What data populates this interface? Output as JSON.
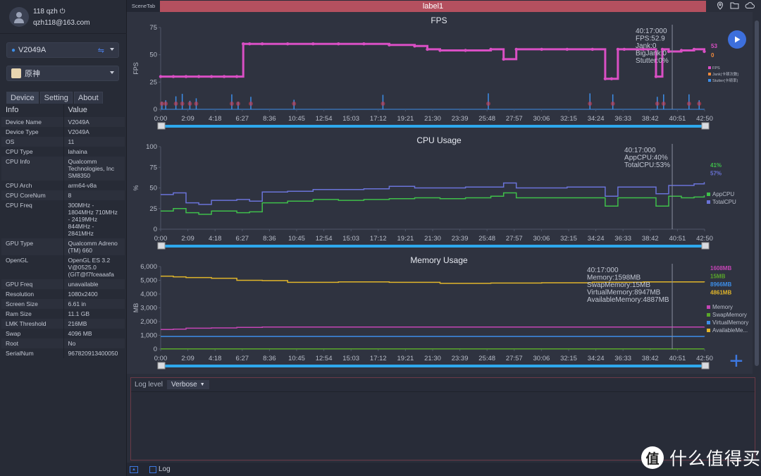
{
  "user": {
    "name": "118 qzh",
    "email": "qzh118@163.com"
  },
  "device_select": {
    "value": "V2049A"
  },
  "app_select": {
    "value": "原神"
  },
  "tabs": [
    {
      "label": "Device"
    },
    {
      "label": "Setting"
    },
    {
      "label": "About"
    }
  ],
  "info_table": {
    "headers": [
      "Info",
      "Value"
    ],
    "rows": [
      [
        "Device Name",
        "V2049A"
      ],
      [
        "Device Type",
        "V2049A"
      ],
      [
        "OS",
        "11"
      ],
      [
        "CPU Type",
        "lahaina"
      ],
      [
        "CPU Info",
        "Qualcomm Technologies, Inc SM8350"
      ],
      [
        "CPU Arch",
        "arm64-v8a"
      ],
      [
        "CPU CoreNum",
        "8"
      ],
      [
        "CPU Freq",
        "300MHz - 1804MHz 710MHz - 2419MHz 844MHz - 2841MHz"
      ],
      [
        "GPU Type",
        "Qualcomm Adreno (TM) 660"
      ],
      [
        "OpenGL",
        "OpenGL ES 3.2 V@0525.0 (GIT@f7fceaaafa"
      ],
      [
        "GPU Freq",
        "unavailable"
      ],
      [
        "Resolution",
        "1080x2400"
      ],
      [
        "Screen Size",
        "6.61 in"
      ],
      [
        "Ram Size",
        "11.1 GB"
      ],
      [
        "LMK Threshold",
        "216MB"
      ],
      [
        "Swap",
        "4096 MB"
      ],
      [
        "Root",
        "No"
      ],
      [
        "SerialNum",
        "967820913400050"
      ]
    ]
  },
  "scene_tab": "SceneTab",
  "label_tab": "label1",
  "log": {
    "level_label": "Log level",
    "level_value": "Verbose",
    "checkbox_label": "Log"
  },
  "watermark": {
    "badge": "值",
    "text": "什么值得买"
  },
  "colors": {
    "fps": "#d94fc4",
    "jank": "#f08a3c",
    "stutter": "#3d8ee8",
    "app_cpu": "#3fbf4a",
    "total_cpu": "#6a73d8",
    "memory": "#c445b5",
    "swap": "#5aa82a",
    "virtual": "#3d8ee8",
    "available": "#e0b52a",
    "label_tab": "#b4505f"
  },
  "chart_data": [
    {
      "type": "line",
      "title": "FPS",
      "ylabel": "FPS",
      "ylim": [
        0,
        75
      ],
      "yticks": [
        "0",
        "25",
        "50",
        "75"
      ],
      "xticks": [
        "0:00",
        "2:09",
        "4:18",
        "6:27",
        "8:36",
        "10:45",
        "12:54",
        "15:03",
        "17:12",
        "19:21",
        "21:30",
        "23:39",
        "25:48",
        "27:57",
        "30:06",
        "32:15",
        "34:24",
        "36:33",
        "38:42",
        "40:51",
        "42:50"
      ],
      "series": [
        {
          "name": "FPS",
          "x_min": [
            0,
            1,
            2,
            3,
            4,
            5,
            6,
            6.5,
            7,
            8,
            10,
            12,
            14,
            16,
            18,
            20,
            21,
            22,
            24,
            26,
            27,
            28,
            30,
            32,
            34,
            35,
            35.5,
            36,
            36.5,
            38,
            39,
            39.5,
            40,
            41,
            42,
            42.8
          ],
          "values": [
            30,
            30,
            30,
            30,
            30,
            30,
            30,
            60,
            60,
            60,
            60,
            60,
            60,
            60,
            59,
            58,
            55,
            54,
            54,
            55,
            46,
            55,
            55,
            55,
            55,
            28,
            28,
            55,
            55,
            55,
            30,
            55,
            53,
            54,
            55,
            53
          ]
        },
        {
          "name": "Jank(卡顿次数)",
          "values": []
        },
        {
          "name": "Stutter(卡顿率)",
          "values": []
        }
      ],
      "current_values": {
        "FPS": "53",
        "Jank": "0"
      },
      "tooltip": {
        "time": "40:17:000",
        "lines": [
          "FPS:52.9",
          "Jank:0",
          "BigJank:0",
          "Stutter:0%"
        ]
      }
    },
    {
      "type": "line",
      "title": "CPU Usage",
      "ylabel": "%",
      "ylim": [
        0,
        100
      ],
      "yticks": [
        "0",
        "25",
        "50",
        "75",
        "100"
      ],
      "xticks": [
        "0:00",
        "2:09",
        "4:18",
        "6:27",
        "8:36",
        "10:45",
        "12:54",
        "15:03",
        "17:12",
        "19:21",
        "21:30",
        "23:39",
        "25:48",
        "27:57",
        "30:06",
        "32:15",
        "34:24",
        "36:33",
        "38:42",
        "40:51",
        "42:50"
      ],
      "series": [
        {
          "name": "AppCPU",
          "x_min": [
            0,
            1,
            2,
            3,
            4,
            5,
            6,
            7,
            8,
            10,
            12,
            14,
            16,
            18,
            20,
            22,
            24,
            26,
            27,
            28,
            30,
            32,
            34,
            35,
            36,
            38,
            39,
            40,
            41,
            42,
            42.8
          ],
          "values": [
            22,
            25,
            20,
            18,
            22,
            22,
            20,
            21,
            32,
            34,
            36,
            35,
            36,
            37,
            38,
            37,
            38,
            40,
            44,
            38,
            38,
            38,
            38,
            28,
            38,
            38,
            28,
            40,
            38,
            39,
            41
          ]
        },
        {
          "name": "TotalCPU",
          "x_min": [
            0,
            1,
            2,
            3,
            4,
            5,
            6,
            7,
            8,
            10,
            12,
            14,
            16,
            18,
            20,
            22,
            24,
            26,
            27,
            28,
            30,
            32,
            34,
            35,
            36,
            38,
            39,
            40,
            41,
            42,
            42.8
          ],
          "values": [
            42,
            44,
            32,
            30,
            35,
            35,
            36,
            34,
            45,
            46,
            48,
            48,
            49,
            52,
            50,
            50,
            51,
            51,
            56,
            50,
            50,
            51,
            51,
            40,
            51,
            51,
            43,
            53,
            53,
            55,
            57
          ]
        }
      ],
      "current_values": {
        "AppCPU": "41%",
        "TotalCPU": "57%"
      },
      "tooltip": {
        "time": "40:17:000",
        "lines": [
          "AppCPU:40%",
          "TotalCPU:53%"
        ]
      }
    },
    {
      "type": "line",
      "title": "Memory Usage",
      "ylabel": "MB",
      "ylim": [
        0,
        6000
      ],
      "yticks": [
        "0",
        "1,000",
        "2,000",
        "3,000",
        "4,000",
        "5,000",
        "6,000"
      ],
      "xticks": [
        "0:00",
        "2:09",
        "4:18",
        "6:27",
        "8:36",
        "10:45",
        "12:54",
        "15:03",
        "17:12",
        "19:21",
        "21:30",
        "23:39",
        "25:48",
        "27:57",
        "30:06",
        "32:15",
        "34:24",
        "36:33",
        "38:42",
        "40:51",
        "42:50"
      ],
      "series": [
        {
          "name": "Memory",
          "x_min": [
            0,
            1,
            2,
            4,
            6,
            8,
            12,
            20,
            30,
            40,
            42.8
          ],
          "values": [
            1420,
            1450,
            1520,
            1540,
            1580,
            1600,
            1600,
            1600,
            1600,
            1600,
            1608
          ]
        },
        {
          "name": "SwapMemory",
          "x_min": [
            0,
            42.8
          ],
          "values": [
            15,
            15
          ]
        },
        {
          "name": "VirtualMemory",
          "x_min": [
            0,
            42.8
          ],
          "values": [
            920,
            900
          ]
        },
        {
          "name": "AvailableMemory",
          "x_min": [
            0,
            1,
            2,
            4,
            6,
            8,
            10,
            14,
            18,
            22,
            26,
            30,
            34,
            38,
            40,
            42.8
          ],
          "values": [
            5300,
            5250,
            5200,
            5150,
            5000,
            4980,
            4850,
            4880,
            4850,
            4780,
            4800,
            4820,
            4860,
            4880,
            4880,
            4861
          ]
        }
      ],
      "legend": [
        "Memory",
        "SwapMemory",
        "VirtualMemory",
        "AvailableMe..."
      ],
      "current_values": {
        "Memory": "1608MB",
        "SwapMemory": "15MB",
        "VirtualMemory": "8966MB",
        "AvailableMemory": "4861MB"
      },
      "tooltip": {
        "time": "40:17:000",
        "lines": [
          "Memory:1598MB",
          "SwapMemory:15MB",
          "VirtualMemory:8947MB",
          "AvailableMemory:4887MB"
        ]
      }
    }
  ]
}
